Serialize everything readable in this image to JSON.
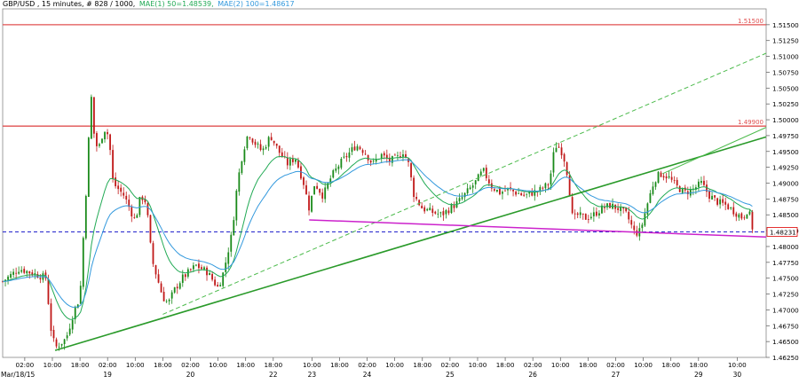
{
  "header": {
    "symbol_line": "GBP/USD , 15 minutes, # 828 / 1000,",
    "ma1_label": "MAE(1) 50=1.48539,",
    "ma2_label": "MAE(2) 100=1.48617"
  },
  "chart_data": {
    "type": "candlestick",
    "ylim": [
      1.4625,
      1.5175
    ],
    "y_ticks": [
      "1.46250",
      "1.46500",
      "1.46750",
      "1.47000",
      "1.47250",
      "1.47500",
      "1.47750",
      "1.48000",
      "1.48250",
      "1.48500",
      "1.48750",
      "1.49000",
      "1.49250",
      "1.49500",
      "1.49750",
      "1.50000",
      "1.50250",
      "1.50500",
      "1.50750",
      "1.51000",
      "1.51250",
      "1.51500"
    ],
    "x_tick_labels": [
      {
        "x": 0.8,
        "time": "02:00"
      },
      {
        "x": 1.8,
        "time": "10:00"
      },
      {
        "x": 2.8,
        "time": "18:00"
      },
      {
        "x": 3.8,
        "time": "02:00",
        "date": "19"
      },
      {
        "x": 4.8,
        "time": "10:00"
      },
      {
        "x": 5.8,
        "time": "18:00"
      },
      {
        "x": 6.8,
        "time": "02:00",
        "date": "20"
      },
      {
        "x": 7.8,
        "time": "10:00"
      },
      {
        "x": 8.8,
        "time": "18:00"
      },
      {
        "x": 9.8,
        "time": "18:00",
        "date": "22"
      },
      {
        "x": 11.2,
        "time": "10:00",
        "date": "23"
      },
      {
        "x": 12.2,
        "time": "18:00"
      },
      {
        "x": 13.2,
        "time": "02:00",
        "date": "24"
      },
      {
        "x": 14.2,
        "time": "10:00"
      },
      {
        "x": 15.2,
        "time": "18:00"
      },
      {
        "x": 16.2,
        "time": "02:00",
        "date": "25"
      },
      {
        "x": 17.2,
        "time": "10:00"
      },
      {
        "x": 18.2,
        "time": "18:00"
      },
      {
        "x": 19.2,
        "time": "02:00",
        "date": "26"
      },
      {
        "x": 20.2,
        "time": "10:00"
      },
      {
        "x": 21.2,
        "time": "18:00"
      },
      {
        "x": 22.2,
        "time": "02:00",
        "date": "27"
      },
      {
        "x": 23.2,
        "time": "10:00"
      },
      {
        "x": 24.2,
        "time": "18:00"
      },
      {
        "x": 25.2,
        "time": "18:00",
        "date": "29"
      },
      {
        "x": 26.6,
        "time": "10:00",
        "date": "30"
      }
    ],
    "first_date_label": "Mar/18/15",
    "horizontal_levels": [
      {
        "value": 1.515,
        "label": "1.51500",
        "color": "#e05050"
      },
      {
        "value": 1.499,
        "label": "1.49900",
        "color": "#e05050"
      }
    ],
    "current_price": {
      "value": 1.48231,
      "label": "1.48231",
      "color": "#2222cc"
    },
    "trendlines": [
      {
        "x1": 1.9,
        "y1": 1.4636,
        "x2": 27.65,
        "y2": 1.4973,
        "color": "#2a9a2a",
        "width": 1.6,
        "dashed": false
      },
      {
        "x1": 5.8,
        "y1": 1.4693,
        "x2": 27.65,
        "y2": 1.5105,
        "color": "#4dbb4d",
        "width": 1,
        "dashed": true
      },
      {
        "x1": 23.9,
        "y1": 1.4915,
        "x2": 27.65,
        "y2": 1.4988,
        "color": "#4dbb4d",
        "width": 1,
        "dashed": false
      },
      {
        "x1": 11.1,
        "y1": 1.4842,
        "x2": 27.65,
        "y2": 1.4815,
        "color": "#cc22cc",
        "width": 1.5,
        "dashed": false
      }
    ],
    "ma1": {
      "name": "MAE(1) 50",
      "value": 1.48539,
      "color": "#22aa55"
    },
    "ma2": {
      "name": "MAE(2) 100",
      "value": 1.48617,
      "color": "#3399dd"
    },
    "close_path": [
      [
        0.0,
        1.4745
      ],
      [
        0.6,
        1.4765
      ],
      [
        1.6,
        1.475
      ],
      [
        1.7,
        1.468
      ],
      [
        1.8,
        1.466
      ],
      [
        1.9,
        1.464
      ],
      [
        2.3,
        1.4655
      ],
      [
        2.6,
        1.47
      ],
      [
        2.8,
        1.472
      ],
      [
        2.9,
        1.48
      ],
      [
        3.0,
        1.487
      ],
      [
        3.1,
        1.496
      ],
      [
        3.2,
        1.502
      ],
      [
        3.25,
        1.5085
      ],
      [
        3.3,
        1.498
      ],
      [
        3.45,
        1.495
      ],
      [
        3.6,
        1.4975
      ],
      [
        3.75,
        1.499
      ],
      [
        3.9,
        1.495
      ],
      [
        4.0,
        1.49
      ],
      [
        4.4,
        1.488
      ],
      [
        4.6,
        1.486
      ],
      [
        4.8,
        1.484
      ],
      [
        5.0,
        1.488
      ],
      [
        5.2,
        1.487
      ],
      [
        5.4,
        1.478
      ],
      [
        5.6,
        1.475
      ],
      [
        5.8,
        1.472
      ],
      [
        6.0,
        1.471
      ],
      [
        6.2,
        1.473
      ],
      [
        6.5,
        1.475
      ],
      [
        7.0,
        1.477
      ],
      [
        7.4,
        1.476
      ],
      [
        7.8,
        1.4735
      ],
      [
        8.0,
        1.476
      ],
      [
        8.3,
        1.482
      ],
      [
        8.5,
        1.49
      ],
      [
        8.7,
        1.495
      ],
      [
        8.9,
        1.498
      ],
      [
        9.1,
        1.4965
      ],
      [
        9.4,
        1.495
      ],
      [
        9.7,
        1.4975
      ],
      [
        10.0,
        1.495
      ],
      [
        10.3,
        1.493
      ],
      [
        10.6,
        1.494
      ],
      [
        10.9,
        1.49
      ],
      [
        11.1,
        1.486
      ],
      [
        11.3,
        1.49
      ],
      [
        11.6,
        1.488
      ],
      [
        11.9,
        1.491
      ],
      [
        12.2,
        1.493
      ],
      [
        12.5,
        1.4945
      ],
      [
        12.8,
        1.496
      ],
      [
        13.1,
        1.495
      ],
      [
        13.4,
        1.493
      ],
      [
        13.7,
        1.4945
      ],
      [
        14.0,
        1.4935
      ],
      [
        14.3,
        1.494
      ],
      [
        14.5,
        1.495
      ],
      [
        14.7,
        1.493
      ],
      [
        14.9,
        1.488
      ],
      [
        15.2,
        1.486
      ],
      [
        15.5,
        1.4855
      ],
      [
        15.9,
        1.485
      ],
      [
        16.2,
        1.486
      ],
      [
        16.5,
        1.487
      ],
      [
        16.8,
        1.4885
      ],
      [
        17.1,
        1.49
      ],
      [
        17.4,
        1.492
      ],
      [
        17.7,
        1.4895
      ],
      [
        18.0,
        1.4885
      ],
      [
        18.3,
        1.489
      ],
      [
        18.6,
        1.4885
      ],
      [
        18.9,
        1.488
      ],
      [
        19.2,
        1.4885
      ],
      [
        19.5,
        1.489
      ],
      [
        19.8,
        1.49
      ],
      [
        20.0,
        1.496
      ],
      [
        20.2,
        1.4955
      ],
      [
        20.4,
        1.493
      ],
      [
        20.55,
        1.488
      ],
      [
        20.65,
        1.484
      ],
      [
        20.8,
        1.485
      ],
      [
        21.1,
        1.4845
      ],
      [
        21.4,
        1.485
      ],
      [
        21.7,
        1.486
      ],
      [
        22.0,
        1.4865
      ],
      [
        22.3,
        1.486
      ],
      [
        22.6,
        1.485
      ],
      [
        22.9,
        1.482
      ],
      [
        23.1,
        1.4825
      ],
      [
        23.3,
        1.486
      ],
      [
        23.6,
        1.4905
      ],
      [
        23.8,
        1.4915
      ],
      [
        24.1,
        1.491
      ],
      [
        24.4,
        1.4895
      ],
      [
        24.7,
        1.4885
      ],
      [
        25.0,
        1.489
      ],
      [
        25.3,
        1.49
      ],
      [
        25.6,
        1.488
      ],
      [
        25.9,
        1.487
      ],
      [
        26.2,
        1.4865
      ],
      [
        26.5,
        1.4855
      ],
      [
        26.8,
        1.4845
      ],
      [
        27.0,
        1.486
      ],
      [
        27.15,
        1.483
      ]
    ]
  }
}
